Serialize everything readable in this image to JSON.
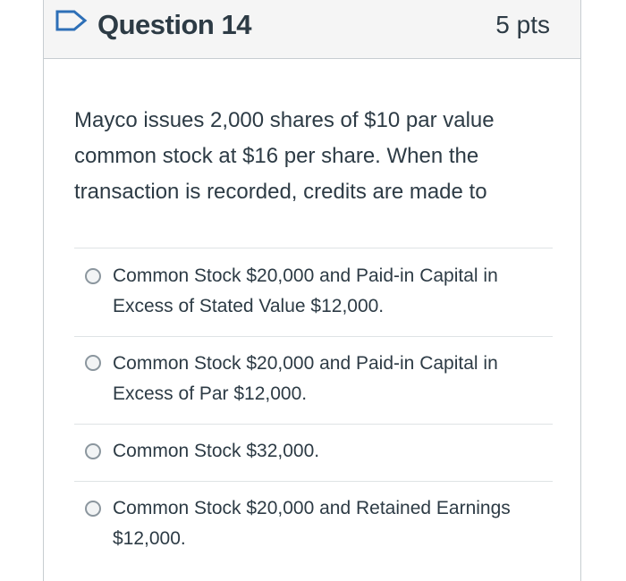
{
  "question": {
    "title": "Question 14",
    "points": "5 pts",
    "text": "Mayco issues 2,000 shares of $10 par value common stock at $16 per share. When the transaction is recorded, credits are made to",
    "flag_icon": "bookmark-flag-icon",
    "accent_color": "#2d6fb7"
  },
  "answers": [
    {
      "label": "Common Stock $20,000 and Paid-in Capital in Excess of Stated Value $12,000."
    },
    {
      "label": "Common Stock $20,000 and Paid-in Capital in Excess of Par $12,000."
    },
    {
      "label": "Common Stock $32,000."
    },
    {
      "label": "Common Stock $20,000 and Retained Earnings $12,000."
    }
  ]
}
